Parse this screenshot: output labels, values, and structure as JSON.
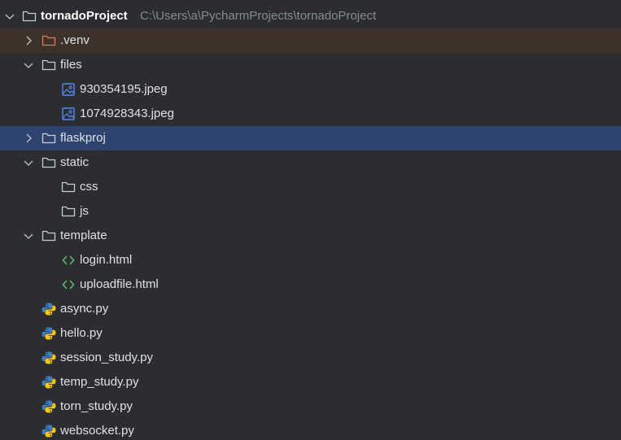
{
  "project": {
    "name": "tornadoProject",
    "path": "C:\\Users\\a\\PycharmProjects\\tornadoProject"
  },
  "items": [
    {
      "label": ".venv"
    },
    {
      "label": "files"
    },
    {
      "label": "930354195.jpeg"
    },
    {
      "label": "1074928343.jpeg"
    },
    {
      "label": "flaskproj"
    },
    {
      "label": "static"
    },
    {
      "label": "css"
    },
    {
      "label": "js"
    },
    {
      "label": "template"
    },
    {
      "label": "login.html"
    },
    {
      "label": "uploadfile.html"
    },
    {
      "label": "async.py"
    },
    {
      "label": "hello.py"
    },
    {
      "label": "session_study.py"
    },
    {
      "label": "temp_study.py"
    },
    {
      "label": "torn_study.py"
    },
    {
      "label": "websocket.py"
    }
  ],
  "colors": {
    "background": "#2b2d30",
    "selected_row": "#2e436e",
    "excluded_row": "#3d3229",
    "excluded_folder": "#e07b53",
    "image_icon": "#548af7",
    "html_icon": "#5fb865",
    "python_blue": "#3c7dc4",
    "python_yellow": "#f5c518"
  }
}
